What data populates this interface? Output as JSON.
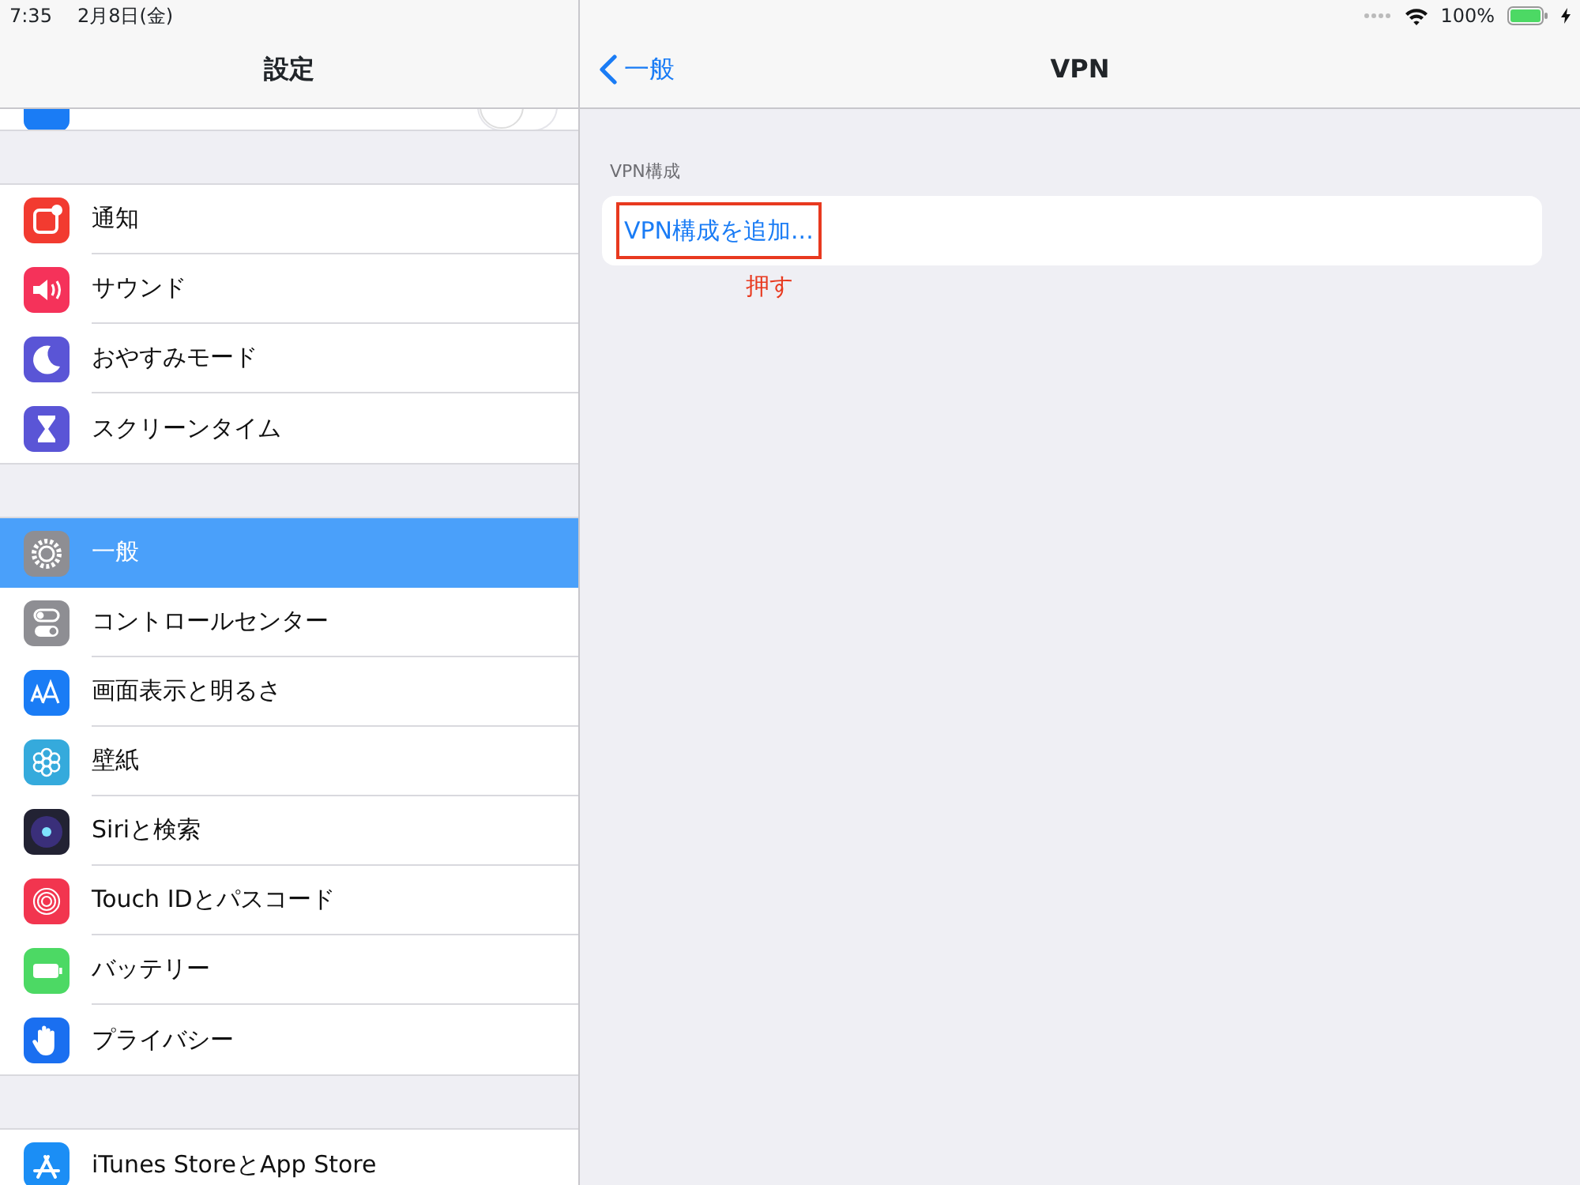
{
  "status_bar": {
    "time": "7:35",
    "date": "2月8日(金)",
    "battery": "100%"
  },
  "sidebar": {
    "title": "設定",
    "cut_off_row": {
      "color": "#1a7cf5",
      "on": false
    },
    "groups": [
      {
        "items": [
          {
            "label": "通知",
            "color": "#f23b30",
            "selected": false
          },
          {
            "label": "サウンド",
            "color": "#f5325a",
            "selected": false
          },
          {
            "label": "おやすみモード",
            "color": "#5a55d6",
            "selected": false
          },
          {
            "label": "スクリーンタイム",
            "color": "#5a55d6",
            "selected": false
          }
        ]
      },
      {
        "items": [
          {
            "label": "一般",
            "color": "#8e8e93",
            "selected": true
          },
          {
            "label": "コントロールセンター",
            "color": "#8e8e93",
            "selected": false
          },
          {
            "label": "画面表示と明るさ",
            "color": "#1a7cf5",
            "selected": false
          },
          {
            "label": "壁紙",
            "color": "#35aadc",
            "selected": false
          },
          {
            "label": "Siriと検索",
            "color": "#222233",
            "selected": false
          },
          {
            "label": "Touch IDとパスコード",
            "color": "#f2354f",
            "selected": false
          },
          {
            "label": "バッテリー",
            "color": "#4cd964",
            "selected": false
          },
          {
            "label": "プライバシー",
            "color": "#1a6ff0",
            "selected": false
          }
        ]
      },
      {
        "items": [
          {
            "label": "iTunes StoreとApp Store",
            "color": "#1b8ef5",
            "selected": false
          }
        ]
      }
    ]
  },
  "detail": {
    "back_label": "一般",
    "title": "VPN",
    "section_label": "VPN構成",
    "action": "VPN構成を追加...",
    "annotation": "押す"
  }
}
